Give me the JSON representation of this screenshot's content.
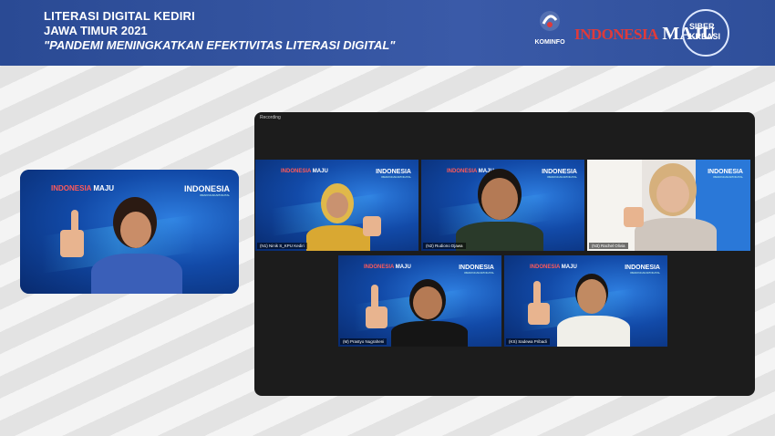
{
  "header": {
    "line1": "LITERASI DIGITAL KEDIRI",
    "line2": "JAWA TIMUR 2021",
    "line3": "\"PANDEMI MENINGKATKAN EFEKTIVITAS LITERASI DIGITAL\"",
    "logos": {
      "kominfo": "KOMINFO",
      "indonesia": "INDONESIA",
      "maju": "MAJU",
      "siber": "SIBER",
      "kreasi": "KREASI"
    }
  },
  "speaker": {
    "brand_a": "INDONESIA",
    "brand_b": "MAJU",
    "indonesia": "INDONESIA",
    "indonesia_sub": "#MAKINCAKAPDIGITAL"
  },
  "zoom": {
    "recording": "Recording",
    "tiles": [
      {
        "name": "(N1) Ninik S_KPU Kediri"
      },
      {
        "name": "(N2) Rudiono Djawa"
      },
      {
        "name": "(N3) Rachel Olivia"
      },
      {
        "name": "(M) Prastyo Nugraheni"
      },
      {
        "name": "(KS) Sadewa Pribadi"
      }
    ],
    "brand_a": "INDONESIA",
    "brand_b": "MAJU",
    "indonesia": "INDONESIA",
    "indonesia_sub": "#MAKINCAKAPDIGITAL"
  },
  "colors": {
    "header_bg": "#2f4f9a",
    "brand_red": "#e03a3a",
    "zoom_bg": "#1c1c1c"
  }
}
